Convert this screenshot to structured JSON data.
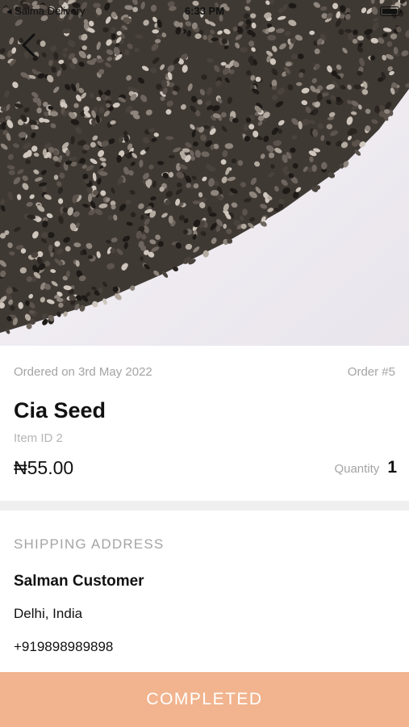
{
  "status_bar": {
    "carrier": "◂ Salma Delivery",
    "time": "6:33 PM"
  },
  "product": {
    "ordered_on": "Ordered on 3rd May 2022",
    "order_no": "Order #5",
    "name": "Cia Seed",
    "item_id": "Item ID 2",
    "price": "₦55.00",
    "quantity_label": "Quantity",
    "quantity_value": "1"
  },
  "shipping": {
    "heading": "SHIPPING ADDRESS",
    "name": "Salman Customer",
    "city": "Delhi, India",
    "phone": "+919898989898"
  },
  "footer": {
    "status_button": "COMPLETED"
  },
  "colors": {
    "accent": "#f1b48e",
    "divider": "#efefef"
  },
  "icons": {
    "back": "chevron-left-icon",
    "wifi": "wifi-icon",
    "battery": "battery-icon"
  }
}
